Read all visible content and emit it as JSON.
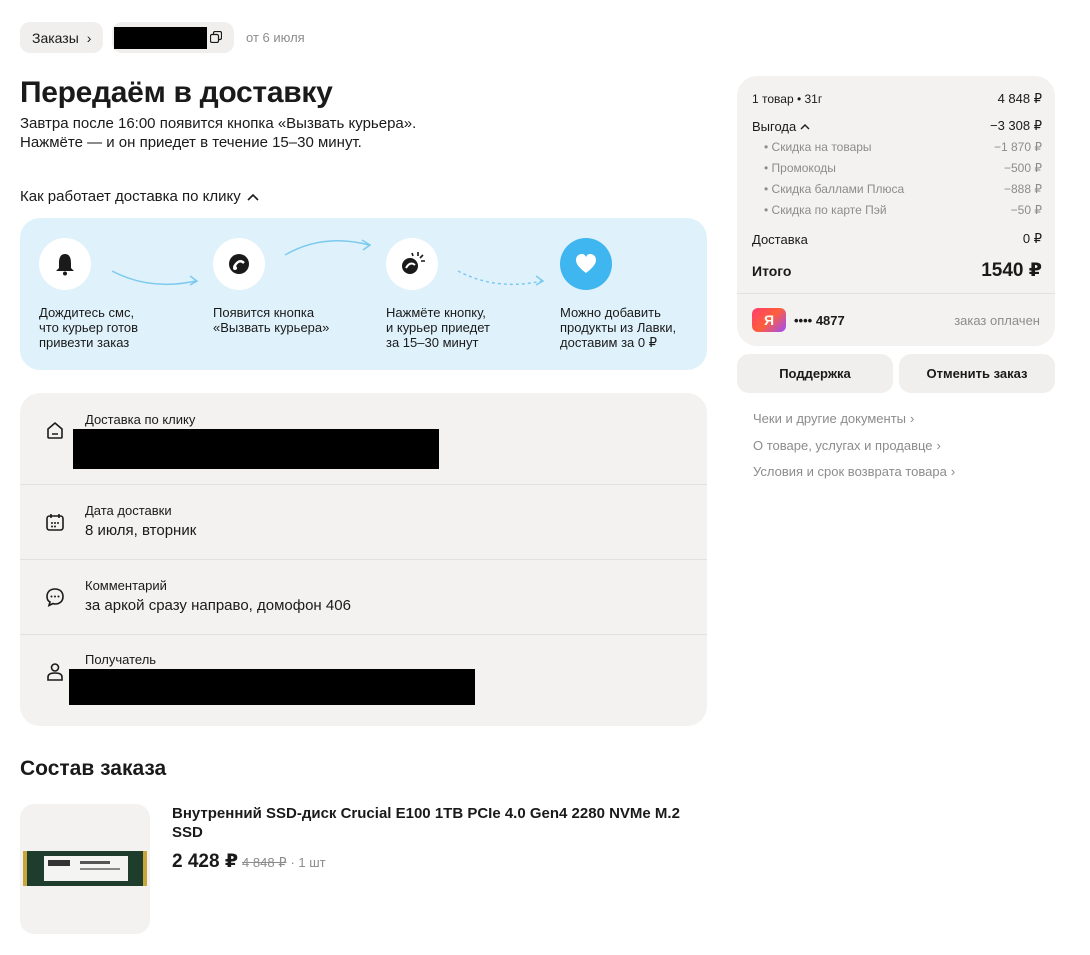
{
  "header": {
    "breadcrumb": "Заказы",
    "order_date": "от 6 июля"
  },
  "status": {
    "title": "Передаём в доставку",
    "line1": "Завтра после 16:00 появится кнопка «Вызвать курьера».",
    "line2": "Нажмёте — и он приедет в течение 15–30 минут.",
    "how_link": "Как работает доставка по клику"
  },
  "steps": [
    {
      "icon": "bell-icon",
      "l1": "Дождитесь смс,",
      "l2": "что курьер готов",
      "l3": "привезти заказ"
    },
    {
      "icon": "tap-icon",
      "l1": "Появится кнопка",
      "l2": "«Вызвать курьера»",
      "l3": ""
    },
    {
      "icon": "press-icon",
      "l1": "Нажмёте кнопку,",
      "l2": "и курьер приедет",
      "l3": "за 15–30 минут"
    },
    {
      "icon": "heart-icon",
      "l1": "Можно добавить",
      "l2": "продукты из Лавки,",
      "l3": "доставим за 0 ₽"
    }
  ],
  "details": {
    "delivery_type_label": "Доставка по клику",
    "date_label": "Дата доставки",
    "date_value": "8 июля, вторник",
    "comment_label": "Комментарий",
    "comment_value": "за аркой сразу направо, домофон 406",
    "recipient_label": "Получатель"
  },
  "order": {
    "section_title": "Состав заказа",
    "product_name": "Внутренний SSD-диск Crucial E100 1TB PCIe 4.0 Gen4 2280 NVMe M.2 SSD",
    "price_now": "2 428 ₽",
    "price_old": "4 848 ₽",
    "qty": "· 1 шт"
  },
  "summary": {
    "items_label": "1 товар • 31г",
    "items_value": "4 848 ₽",
    "benefit_label": "Выгода",
    "benefit_value": "−3 308 ₽",
    "sub": [
      {
        "label": "• Скидка на товары",
        "value": "−1 870 ₽"
      },
      {
        "label": "• Промокоды",
        "value": "−500 ₽"
      },
      {
        "label": "• Скидка баллами Плюса",
        "value": "−888 ₽"
      },
      {
        "label": "• Скидка по карте Пэй",
        "value": "−50 ₽"
      }
    ],
    "delivery_label": "Доставка",
    "delivery_value": "0 ₽",
    "total_label": "Итого",
    "total_value": "1540 ₽",
    "bank_logo": "Я",
    "card": "•••• 4877",
    "paid": "заказ оплачен"
  },
  "actions": {
    "support": "Поддержка",
    "cancel": "Отменить заказ"
  },
  "links": [
    "Чеки и другие документы",
    "О товаре, услугах и продавце",
    "Условия и срок возврата товара"
  ],
  "colors": {
    "steps_bg": "#dff2fb",
    "accent_blue": "#3fb6f0",
    "card_bg": "#f3f2f0"
  }
}
